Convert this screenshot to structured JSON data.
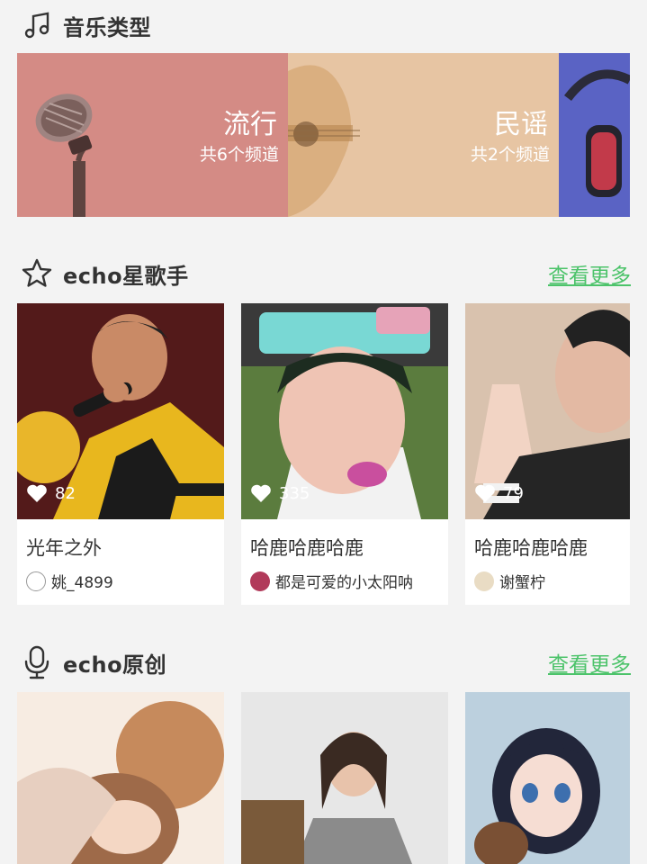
{
  "music_types": {
    "title": "音乐类型",
    "genres": [
      {
        "name": "流行",
        "count": "共6个频道"
      },
      {
        "name": "民谣",
        "count": "共2个频道"
      },
      {
        "name": "",
        "count": ""
      }
    ]
  },
  "star_singers": {
    "title": "echo星歌手",
    "more_label": "查看更多",
    "cards": [
      {
        "likes": "82",
        "title": "光年之外",
        "author": "姚_4899"
      },
      {
        "likes": "335",
        "title": "哈鹿哈鹿哈鹿",
        "author": "都是可爱的小太阳呐"
      },
      {
        "likes": "79",
        "title": "哈鹿哈鹿哈鹿",
        "author": "谢蟹柠"
      }
    ]
  },
  "originals": {
    "title": "echo原创",
    "more_label": "查看更多"
  },
  "colors": {
    "accent": "#4cc36a",
    "background": "#f3f3f3",
    "pop_banner": "#d48b85",
    "folk_banner": "#e7c5a3",
    "rock_banner": "#5a63c4"
  }
}
